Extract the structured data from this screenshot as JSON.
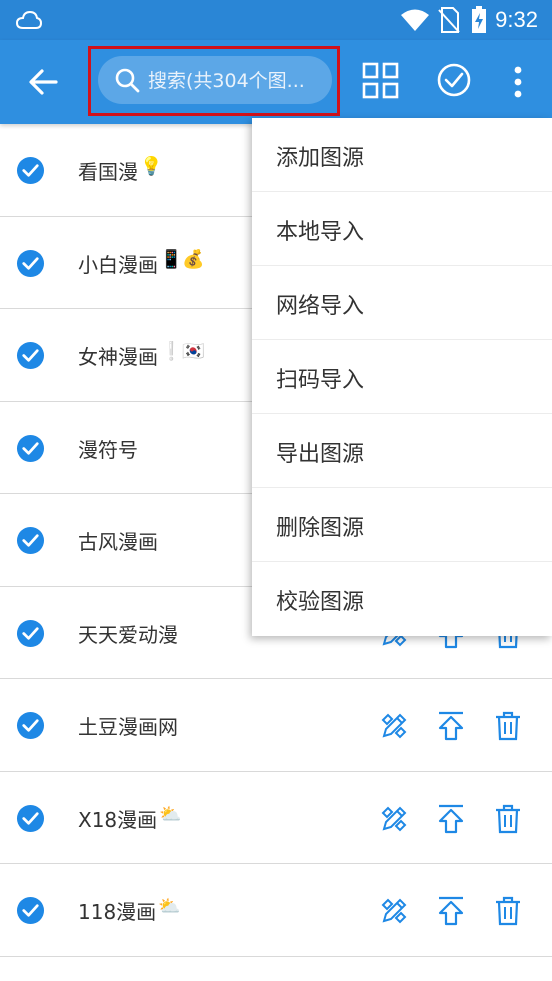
{
  "status_bar": {
    "time": "9:32",
    "icons": [
      "cloud-icon",
      "wifi-icon",
      "no-sim-icon",
      "battery-charging-icon"
    ]
  },
  "toolbar": {
    "search_placeholder": "搜索(共304个图...",
    "icons": [
      "back-arrow-icon",
      "search-icon",
      "grid-icon",
      "check-circle-icon",
      "more-vert-icon"
    ]
  },
  "sources": [
    {
      "name": "看国漫",
      "emoji": "💡",
      "checked": true
    },
    {
      "name": "小白漫画",
      "emoji": "📱💰",
      "checked": true
    },
    {
      "name": "女神漫画",
      "emoji": "❕🇰🇷",
      "checked": true
    },
    {
      "name": "漫符号",
      "emoji": "",
      "checked": true
    },
    {
      "name": "古风漫画",
      "emoji": "",
      "checked": true
    },
    {
      "name": "天天爱动漫",
      "emoji": "",
      "checked": true
    },
    {
      "name": "土豆漫画网",
      "emoji": "",
      "checked": true
    },
    {
      "name": "X18漫画",
      "emoji": "⛅",
      "checked": true
    },
    {
      "name": "118漫画",
      "emoji": "⛅",
      "checked": true
    }
  ],
  "row_action_icons": [
    "edit-icon",
    "move-to-top-icon",
    "delete-icon"
  ],
  "menu": {
    "items": [
      "添加图源",
      "本地导入",
      "网络导入",
      "扫码导入",
      "导出图源",
      "删除图源",
      "校验图源"
    ]
  },
  "colors": {
    "toolbar": "#2f8fe0",
    "statusbar": "#2a86d6",
    "accent": "#1e88e5",
    "highlight_border": "#d0121b"
  }
}
